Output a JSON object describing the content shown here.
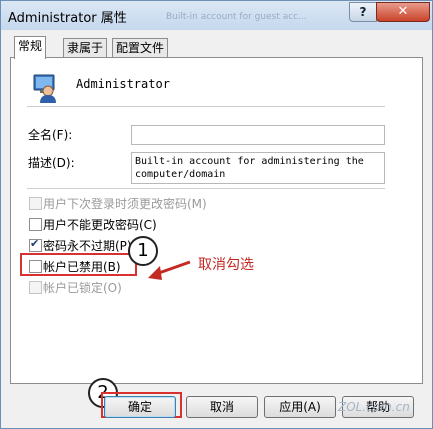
{
  "window": {
    "title": "Administrator 属性",
    "ghost_title": "Built-in account for guest acc...",
    "help_icon": "question-mark",
    "close_icon": "close-x"
  },
  "tabs": [
    {
      "label": "常规",
      "active": true
    },
    {
      "label": "隶属于",
      "active": false
    },
    {
      "label": "配置文件",
      "active": false
    }
  ],
  "user": {
    "icon": "user-account-icon",
    "name": "Administrator"
  },
  "fields": {
    "fullname_label": "全名(F):",
    "fullname_value": "",
    "description_label": "描述(D):",
    "description_value": "Built-in account for administering the computer/domain"
  },
  "options": [
    {
      "label": "用户下次登录时须更改密码(M)",
      "checked": false,
      "disabled": true
    },
    {
      "label": "用户不能更改密码(C)",
      "checked": false,
      "disabled": false
    },
    {
      "label": "密码永不过期(P)",
      "checked": true,
      "disabled": false
    },
    {
      "label": "帐户已禁用(B)",
      "checked": false,
      "disabled": false
    },
    {
      "label": "帐户已锁定(O)",
      "checked": false,
      "disabled": true
    }
  ],
  "annotations": {
    "badge1": "1",
    "badge2": "2",
    "note": "取消勾选",
    "highlight_color": "#d9312f"
  },
  "buttons": {
    "ok": "确定",
    "cancel": "取消",
    "apply": "应用(A)",
    "help": "帮助"
  },
  "watermark": "ZOL.com.cn"
}
